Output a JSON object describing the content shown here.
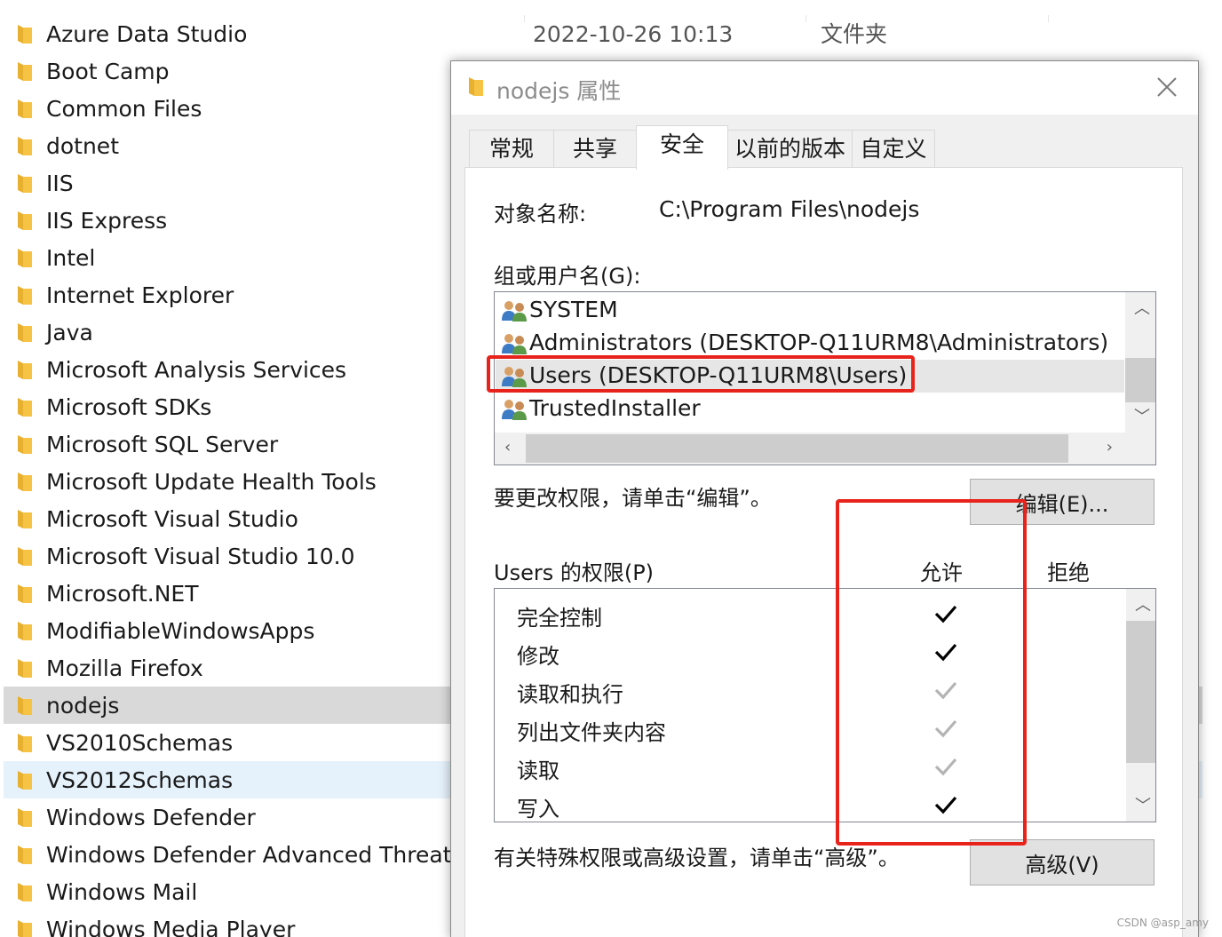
{
  "explorer": {
    "header": {
      "date": "2022-10-26 10:13",
      "type": "文件夹"
    },
    "files": [
      {
        "name": "Azure Data Studio",
        "state": "normal"
      },
      {
        "name": "Boot Camp",
        "state": "normal"
      },
      {
        "name": "Common Files",
        "state": "normal"
      },
      {
        "name": "dotnet",
        "state": "normal"
      },
      {
        "name": "IIS",
        "state": "normal"
      },
      {
        "name": "IIS Express",
        "state": "normal"
      },
      {
        "name": "Intel",
        "state": "normal"
      },
      {
        "name": "Internet Explorer",
        "state": "normal"
      },
      {
        "name": "Java",
        "state": "normal"
      },
      {
        "name": "Microsoft Analysis Services",
        "state": "normal"
      },
      {
        "name": "Microsoft SDKs",
        "state": "normal"
      },
      {
        "name": "Microsoft SQL Server",
        "state": "normal"
      },
      {
        "name": "Microsoft Update Health Tools",
        "state": "normal"
      },
      {
        "name": "Microsoft Visual Studio",
        "state": "normal"
      },
      {
        "name": "Microsoft Visual Studio 10.0",
        "state": "normal"
      },
      {
        "name": "Microsoft.NET",
        "state": "normal"
      },
      {
        "name": "ModifiableWindowsApps",
        "state": "normal"
      },
      {
        "name": "Mozilla Firefox",
        "state": "normal"
      },
      {
        "name": "nodejs",
        "state": "selected"
      },
      {
        "name": "VS2010Schemas",
        "state": "normal"
      },
      {
        "name": "VS2012Schemas",
        "state": "hover"
      },
      {
        "name": "Windows Defender",
        "state": "normal"
      },
      {
        "name": "Windows Defender Advanced Threat Pro",
        "state": "normal"
      },
      {
        "name": "Windows Mail",
        "state": "normal"
      },
      {
        "name": "Windows Media Player",
        "state": "normal"
      }
    ]
  },
  "dialog": {
    "title": "nodejs 属性",
    "tabs": [
      "常规",
      "共享",
      "安全",
      "以前的版本",
      "自定义"
    ],
    "active_tab": "安全",
    "object_label": "对象名称:",
    "object_value": "C:\\Program Files\\nodejs",
    "group_label": "组或用户名(G):",
    "users": [
      {
        "name": "SYSTEM",
        "selected": false
      },
      {
        "name": "Administrators (DESKTOP-Q11URM8\\Administrators)",
        "selected": false
      },
      {
        "name": "Users (DESKTOP-Q11URM8\\Users)",
        "selected": true
      },
      {
        "name": "TrustedInstaller",
        "selected": false
      }
    ],
    "change_hint": "要更改权限，请单击“编辑”。",
    "edit_button": "编辑(E)...",
    "perm_label": "Users 的权限(P)",
    "allow_header": "允许",
    "deny_header": "拒绝",
    "permissions": [
      {
        "name": "完全控制",
        "allow": "checked",
        "deny": "none"
      },
      {
        "name": "修改",
        "allow": "checked",
        "deny": "none"
      },
      {
        "name": "读取和执行",
        "allow": "inherited",
        "deny": "none"
      },
      {
        "name": "列出文件夹内容",
        "allow": "inherited",
        "deny": "none"
      },
      {
        "name": "读取",
        "allow": "inherited",
        "deny": "none"
      },
      {
        "name": "写入",
        "allow": "checked",
        "deny": "none"
      }
    ],
    "advanced_hint": "有关特殊权限或高级设置，请单击“高级”。",
    "advanced_button": "高级(V)"
  },
  "watermark": "CSDN @asp_amy",
  "colors": {
    "highlight_box": "#e8231c",
    "folder": "#f6c344",
    "check_active": "#000000",
    "check_inherited": "#b4b4b4"
  }
}
